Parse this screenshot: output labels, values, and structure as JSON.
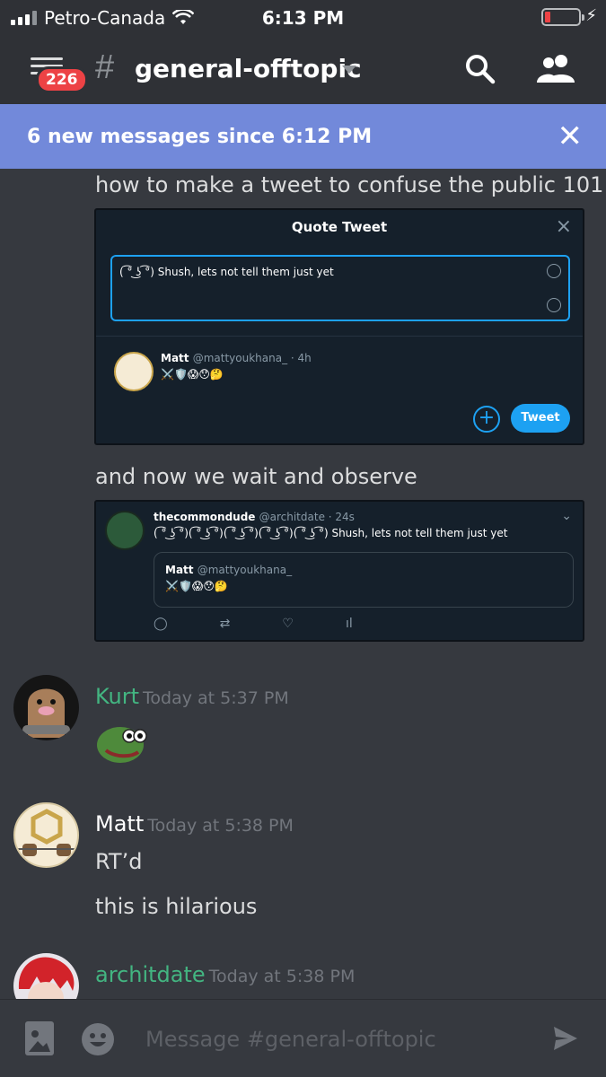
{
  "status": {
    "carrier": "Petro-Canada",
    "time": "6:13 PM"
  },
  "header": {
    "badge": "226",
    "channel": "general-offtopic"
  },
  "new_messages": {
    "text": "6 new messages since 6:12 PM"
  },
  "messages": {
    "matt_top_1": "how to make a tweet to confuse the public 101",
    "quote_tweet": {
      "title": "Quote Tweet",
      "input_text": "( ͡° ͜ʖ ͡°) Shush, lets not tell them just yet",
      "quoted_name": "Matt",
      "quoted_handle": "@mattyoukhana_ · 4h",
      "quoted_bio": "⚔️🛡️😱😯🤔",
      "tweet_button": "Tweet"
    },
    "matt_top_2": "and now we wait and observe",
    "tweet": {
      "name": "thecommondude",
      "handle": "@architdate · 24s",
      "text": "( ͡° ͜ʖ ͡°)( ͡° ͜ʖ ͡°)( ͡° ͜ʖ ͡°)( ͡° ͜ʖ ͡°)( ͡° ͜ʖ ͡°) Shush, lets not tell them just yet",
      "quoted_name": "Matt",
      "quoted_handle": "@mattyoukhana_",
      "quoted_bio": "⚔️🛡️😱😯🤔"
    },
    "kurt": {
      "name": "Kurt",
      "time": "Today at 5:37 PM"
    },
    "matt": {
      "name": "Matt",
      "time": "Today at 5:38 PM",
      "line1": "RT’d",
      "line2": "this is hilarious"
    },
    "archit": {
      "name": "architdate",
      "time": "Today at 5:38 PM"
    }
  },
  "input": {
    "placeholder": "Message #general-offtopic"
  },
  "colors": {
    "accent": "#7289da",
    "green_name": "#43b581",
    "badge": "#ed4245"
  }
}
